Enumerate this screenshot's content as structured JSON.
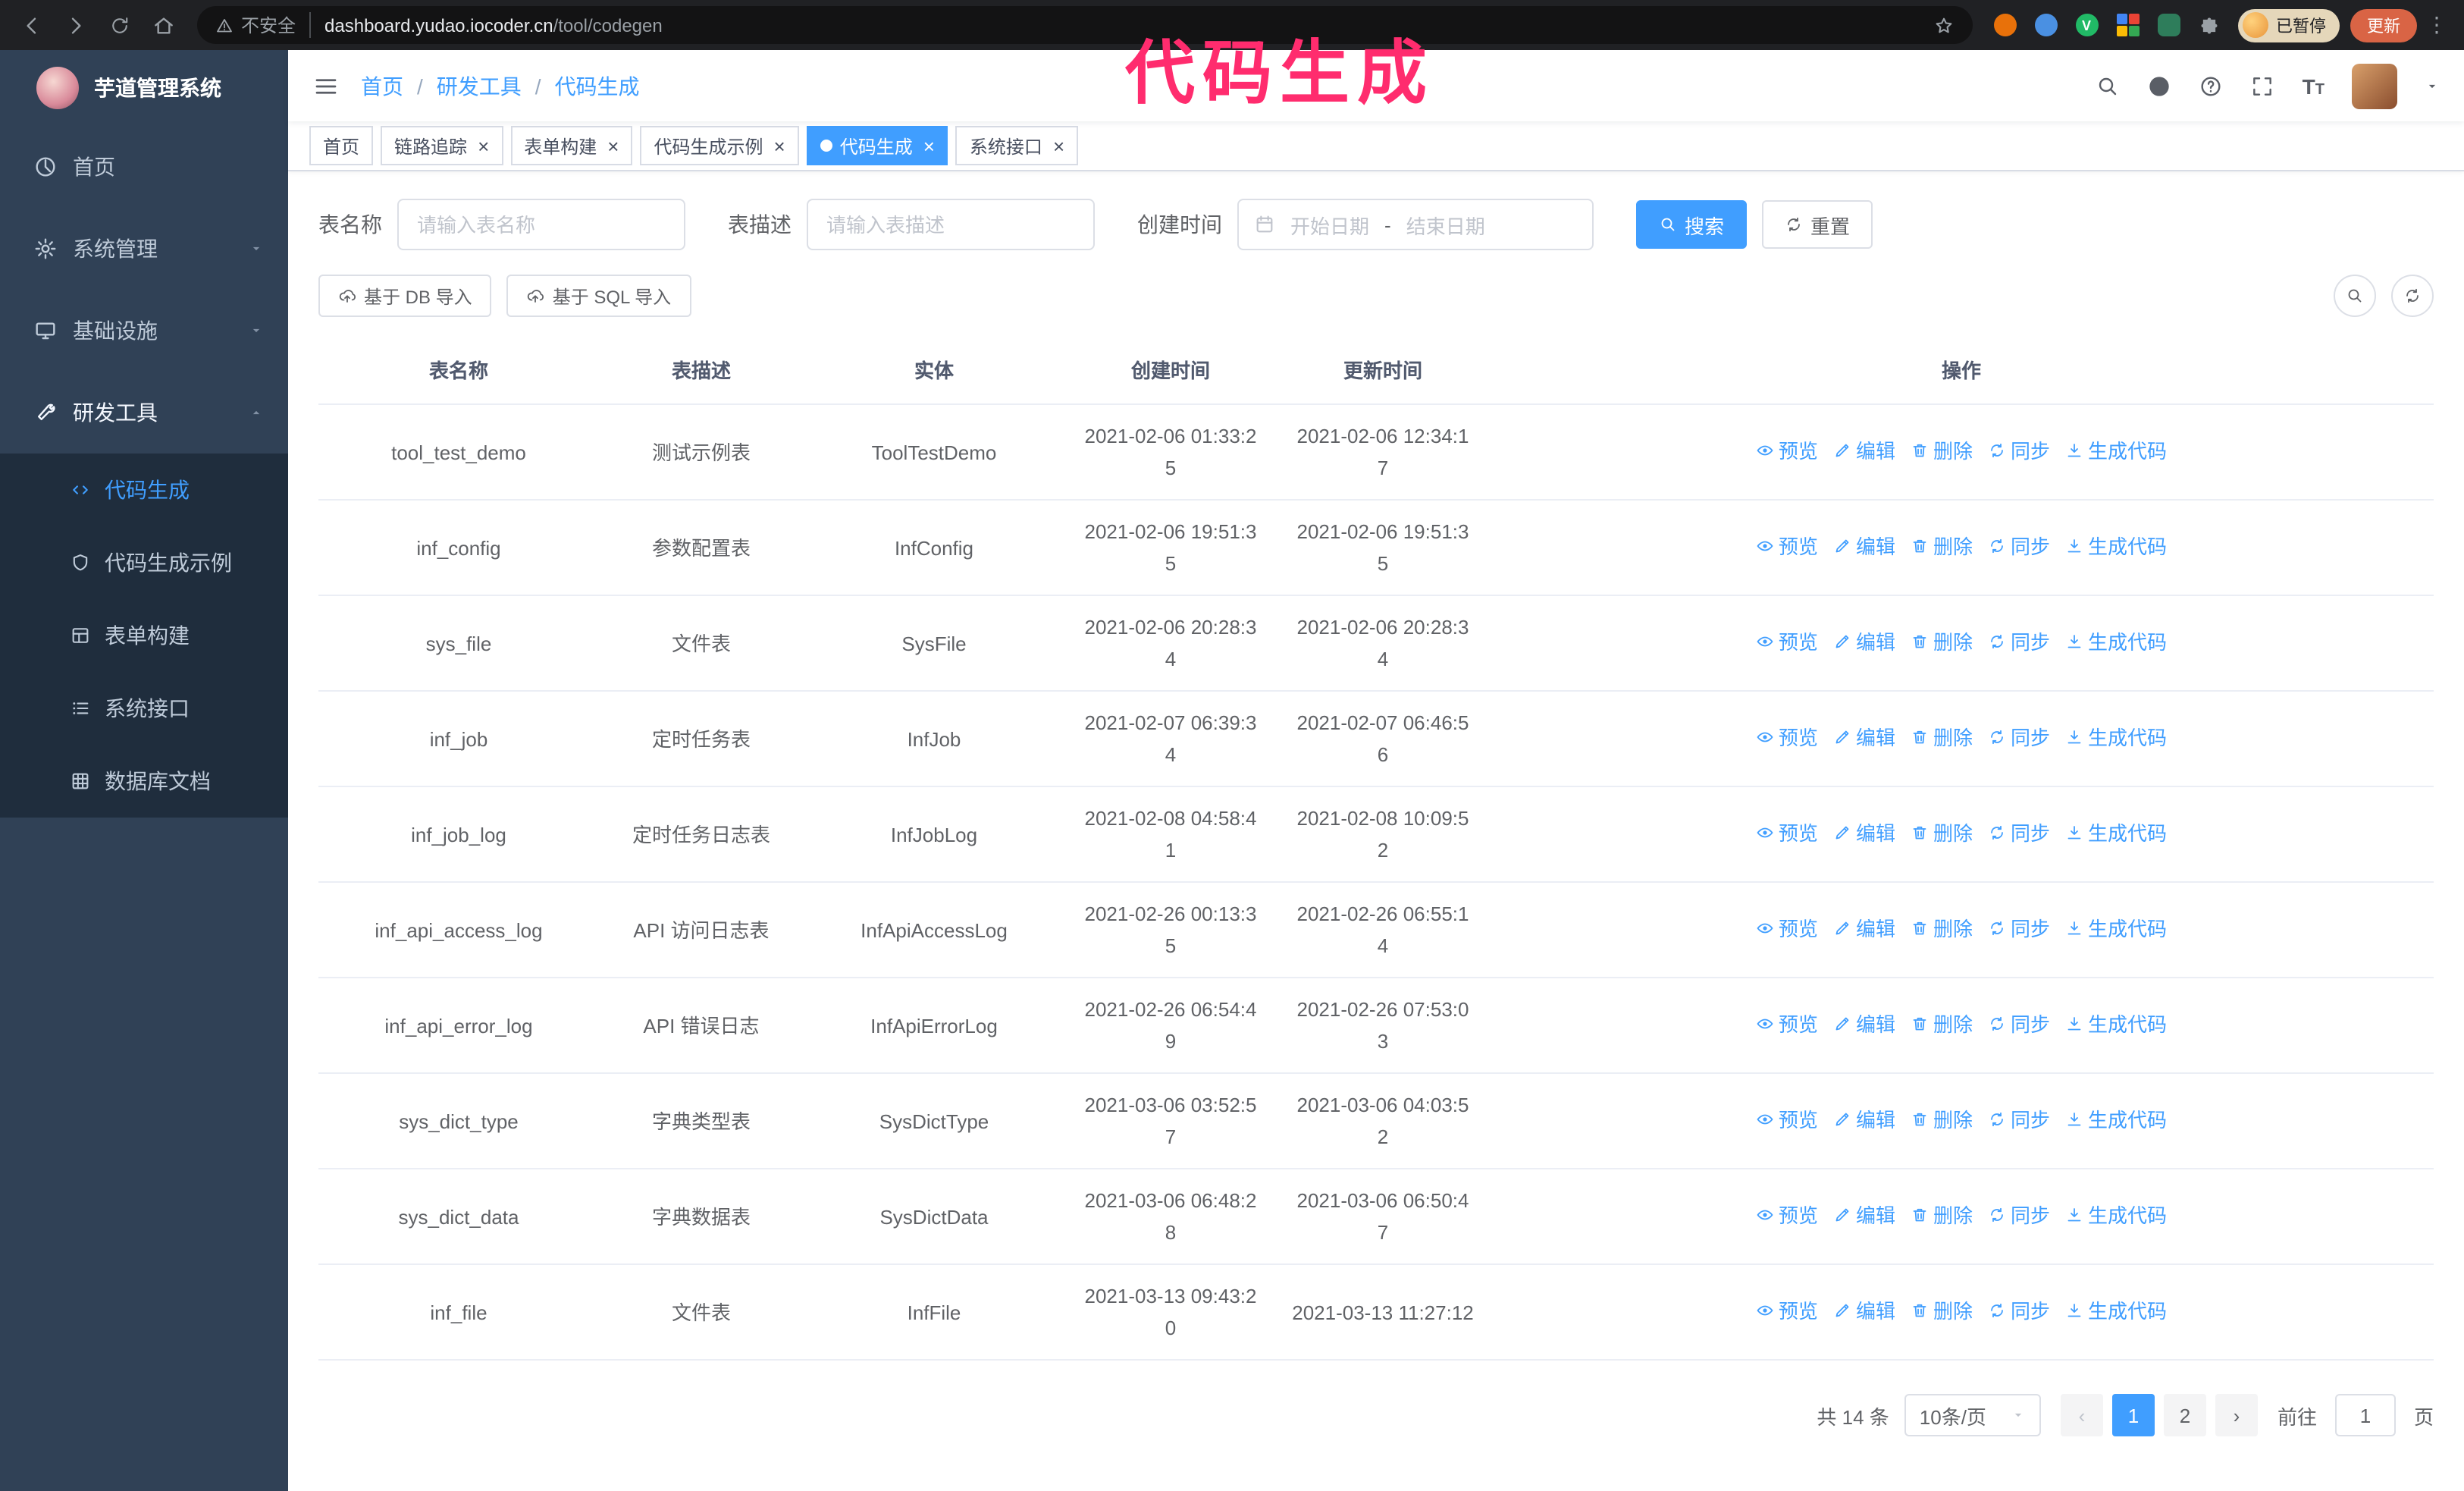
{
  "annotation": {
    "text": "代码生成",
    "color": "#ff2c6e"
  },
  "browser": {
    "security_label": "不安全",
    "url_host": "dashboard.yudao.iocoder.cn",
    "url_path": "/tool/codegen",
    "profile_badge": "已暂停",
    "update_button": "更新"
  },
  "sidebar": {
    "logo_title": "芋道管理系统",
    "menu": [
      {
        "key": "home",
        "label": "首页",
        "icon": "gauge-icon",
        "expandable": false,
        "expanded": false
      },
      {
        "key": "system-admin",
        "label": "系统管理",
        "icon": "gear-icon",
        "expandable": true,
        "expanded": false
      },
      {
        "key": "infrastructure",
        "label": "基础设施",
        "icon": "monitor-icon",
        "expandable": true,
        "expanded": false
      },
      {
        "key": "dev-tools",
        "label": "研发工具",
        "icon": "tools-icon",
        "expandable": true,
        "expanded": true
      }
    ],
    "submenu": [
      {
        "key": "codegen",
        "label": "代码生成",
        "icon": "code-icon",
        "active": true
      },
      {
        "key": "codegen-example",
        "label": "代码生成示例",
        "icon": "shield-icon",
        "active": false
      },
      {
        "key": "form-builder",
        "label": "表单构建",
        "icon": "form-icon",
        "active": false
      },
      {
        "key": "system-api",
        "label": "系统接口",
        "icon": "api-icon",
        "active": false
      },
      {
        "key": "db-doc",
        "label": "数据库文档",
        "icon": "grid-icon",
        "active": false
      }
    ]
  },
  "header": {
    "breadcrumb": [
      "首页",
      "研发工具",
      "代码生成"
    ]
  },
  "tabs": [
    {
      "key": "home",
      "label": "首页",
      "closable": false,
      "active": false
    },
    {
      "key": "tracer",
      "label": "链路追踪",
      "closable": true,
      "active": false
    },
    {
      "key": "form-builder",
      "label": "表单构建",
      "closable": true,
      "active": false
    },
    {
      "key": "codegen-example",
      "label": "代码生成示例",
      "closable": true,
      "active": false
    },
    {
      "key": "codegen",
      "label": "代码生成",
      "closable": true,
      "active": true
    },
    {
      "key": "system-api",
      "label": "系统接口",
      "closable": true,
      "active": false
    }
  ],
  "filters": {
    "table_name_label": "表名称",
    "table_name_placeholder": "请输入表名称",
    "table_desc_label": "表描述",
    "table_desc_placeholder": "请输入表描述",
    "create_time_label": "创建时间",
    "date_start_placeholder": "开始日期",
    "date_separator": "-",
    "date_end_placeholder": "结束日期",
    "search_button": "搜索",
    "reset_button": "重置"
  },
  "toolbar": {
    "import_db_button": "基于 DB 导入",
    "import_sql_button": "基于 SQL 导入"
  },
  "table": {
    "columns": [
      "表名称",
      "表描述",
      "实体",
      "创建时间",
      "更新时间",
      "操作"
    ],
    "actions": [
      {
        "label": "预览",
        "icon": "eye-icon"
      },
      {
        "label": "编辑",
        "icon": "edit-icon"
      },
      {
        "label": "删除",
        "icon": "delete-icon"
      },
      {
        "label": "同步",
        "icon": "sync-icon"
      },
      {
        "label": "生成代码",
        "icon": "download-icon"
      }
    ],
    "rows": [
      {
        "name": "tool_test_demo",
        "desc": "测试示例表",
        "entity": "ToolTestDemo",
        "created": "2021-02-06 01:33:25",
        "updated": "2021-02-06 12:34:17"
      },
      {
        "name": "inf_config",
        "desc": "参数配置表",
        "entity": "InfConfig",
        "created": "2021-02-06 19:51:35",
        "updated": "2021-02-06 19:51:35"
      },
      {
        "name": "sys_file",
        "desc": "文件表",
        "entity": "SysFile",
        "created": "2021-02-06 20:28:34",
        "updated": "2021-02-06 20:28:34"
      },
      {
        "name": "inf_job",
        "desc": "定时任务表",
        "entity": "InfJob",
        "created": "2021-02-07 06:39:34",
        "updated": "2021-02-07 06:46:56"
      },
      {
        "name": "inf_job_log",
        "desc": "定时任务日志表",
        "entity": "InfJobLog",
        "created": "2021-02-08 04:58:41",
        "updated": "2021-02-08 10:09:52"
      },
      {
        "name": "inf_api_access_log",
        "desc": "API 访问日志表",
        "entity": "InfApiAccessLog",
        "created": "2021-02-26 00:13:35",
        "updated": "2021-02-26 06:55:14"
      },
      {
        "name": "inf_api_error_log",
        "desc": "API 错误日志",
        "entity": "InfApiErrorLog",
        "created": "2021-02-26 06:54:49",
        "updated": "2021-02-26 07:53:03"
      },
      {
        "name": "sys_dict_type",
        "desc": "字典类型表",
        "entity": "SysDictType",
        "created": "2021-03-06 03:52:57",
        "updated": "2021-03-06 04:03:52"
      },
      {
        "name": "sys_dict_data",
        "desc": "字典数据表",
        "entity": "SysDictData",
        "created": "2021-03-06 06:48:28",
        "updated": "2021-03-06 06:50:47"
      },
      {
        "name": "inf_file",
        "desc": "文件表",
        "entity": "InfFile",
        "created": "2021-03-13 09:43:20",
        "updated": "2021-03-13 11:27:12"
      }
    ]
  },
  "pagination": {
    "total_text": "共 14 条",
    "page_size_label": "10条/页",
    "pages": [
      "1",
      "2"
    ],
    "active_page": "1",
    "goto_label": "前往",
    "goto_value": "1",
    "goto_suffix": "页"
  }
}
